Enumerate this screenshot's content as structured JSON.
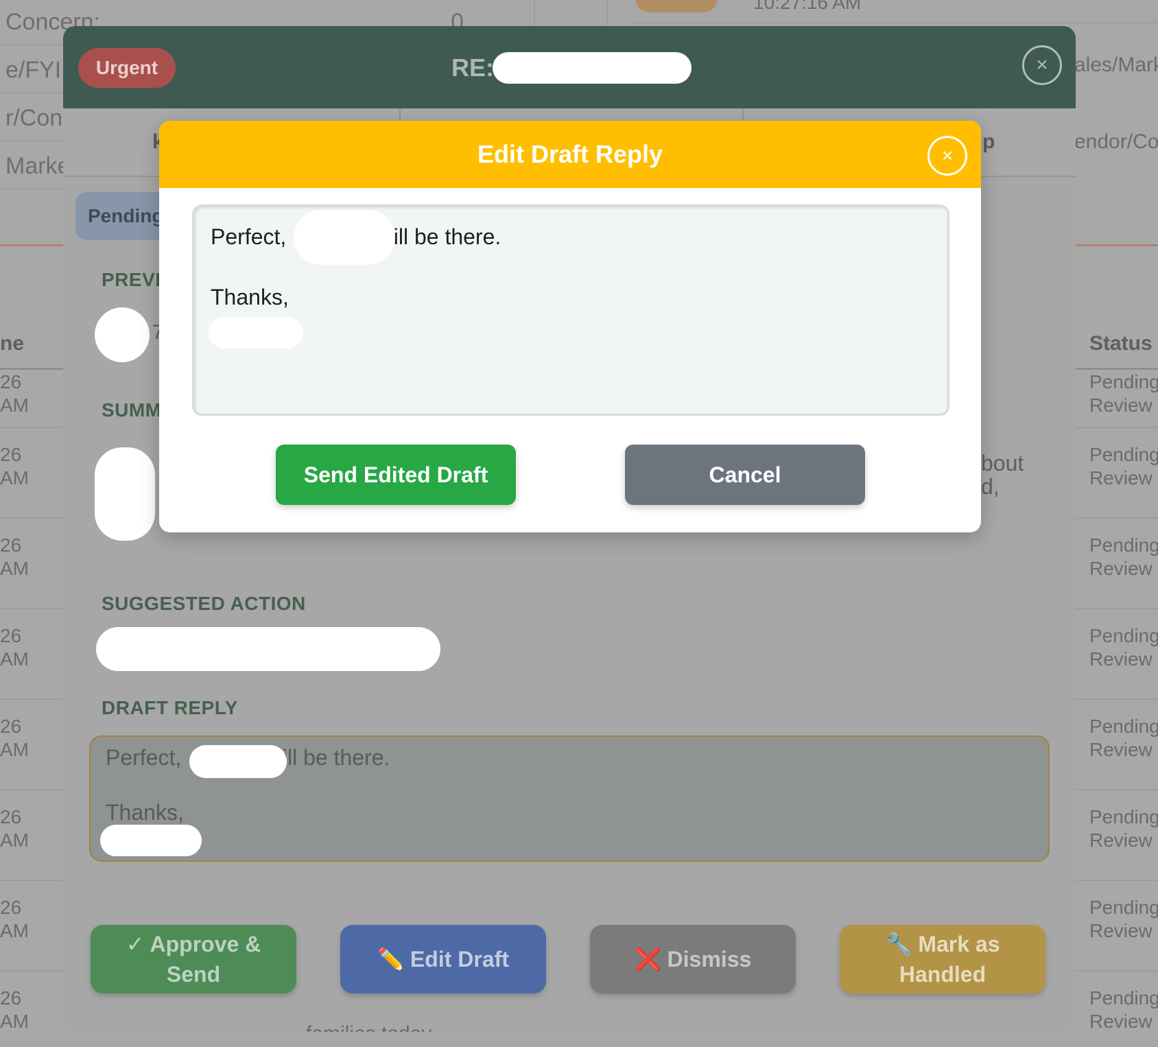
{
  "background": {
    "top_left_rows": [
      {
        "label": "Concern:",
        "value": "0"
      },
      {
        "label": "e/FYI:",
        "value": ""
      },
      {
        "label": "r/Cont",
        "value": ""
      },
      {
        "label": "Marke",
        "value": ""
      }
    ],
    "top_right": {
      "time": "10:27:16 AM",
      "cell_1": "ales/Mark",
      "cell_2": "endor/Co"
    },
    "table_header_left": "ne",
    "table_header_right": "Status",
    "rows_left": [
      "26\nAM",
      "26\nAM",
      "26\nAM",
      "26\nAM",
      "26\nAM",
      "26\nAM",
      "26\nAM",
      "26\nAM"
    ],
    "rows_right": [
      "Pending\nReview",
      "Pending\nReview",
      "Pending\nReview",
      "Pending\nReview",
      "Pending\nReview",
      "Pending\nReview",
      "Pending\nReview",
      "Pending\nReview"
    ],
    "first_row_left": "26\nAM",
    "first_row_right": "Pending\nReview"
  },
  "detail_modal": {
    "priority_badge": "Urgent",
    "subject_prefix": "RE:",
    "close_symbol": "×",
    "tab_fragment_left": "k",
    "tab_fragment_right": "p",
    "status_pill": "Pending",
    "sections": {
      "preview_label": "PREVI",
      "summary_label": "SUMM",
      "suggested_action_label": "SUGGESTED ACTION",
      "draft_reply_label": "DRAFT REPLY"
    },
    "avatar_fragment": "7",
    "summary_fragment": "bout\nd,",
    "draft_reply_text": "Perfect,              will be there.\n\nThanks,",
    "buttons": {
      "approve_icon": "✓",
      "approve_label": "Approve & Send",
      "edit_icon": "✏️",
      "edit_label": "Edit Draft",
      "dismiss_icon": "❌",
      "dismiss_label": "Dismiss",
      "handled_icon": "🔧",
      "handled_label": "Mark as Handled"
    },
    "bottom_fragment": "families today"
  },
  "edit_modal": {
    "title": "Edit Draft Reply",
    "close_symbol": "×",
    "draft_text": "Perfect,               will be there.\n\nThanks,",
    "send_button": "Send Edited Draft",
    "cancel_button": "Cancel"
  },
  "colors": {
    "edit_header": "#ffbf00",
    "send_button": "#28a745",
    "cancel_button": "#6c757d",
    "detail_header": "#3e5a51"
  }
}
